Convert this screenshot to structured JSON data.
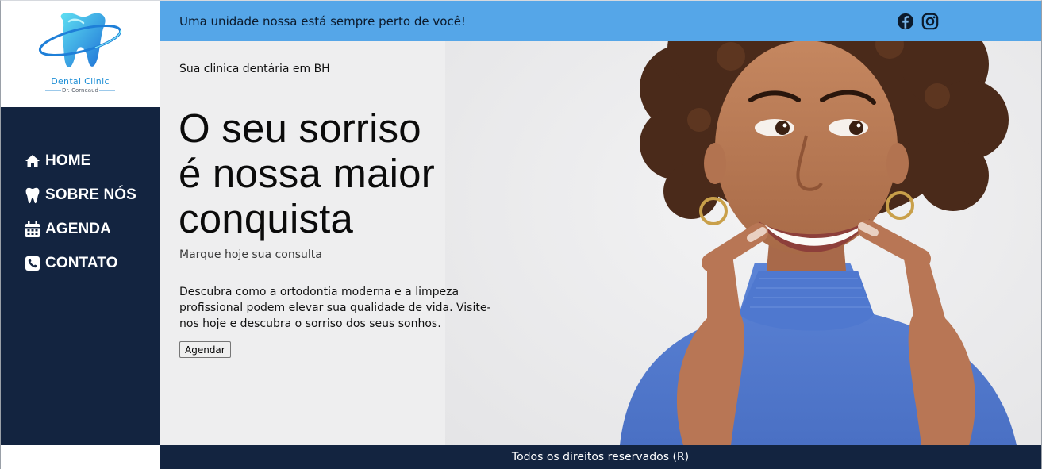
{
  "brand": {
    "name": "Dental Clinic",
    "subtitle": "Dr. Corneaud",
    "logo_icon": "tooth-orbit-logo",
    "logo_color": "#1f8fd6"
  },
  "sidebar": {
    "background": "#132440",
    "items": [
      {
        "label": "HOME",
        "icon": "home-icon"
      },
      {
        "label": "SOBRE NÓS",
        "icon": "tooth-icon"
      },
      {
        "label": "AGENDA",
        "icon": "calendar-icon"
      },
      {
        "label": "CONTATO",
        "icon": "phone-icon"
      }
    ]
  },
  "topbar": {
    "message": "Uma unidade nossa está sempre perto de você!",
    "background": "#55a6e8",
    "social": [
      "facebook-icon",
      "instagram-icon"
    ]
  },
  "hero": {
    "tagline": "Sua clinica dentária em BH",
    "headline_lines": [
      "O seu sorriso",
      "é nossa maior",
      "conquista"
    ],
    "subhead": "Marque hoje sua consulta",
    "description": "Descubra como a ortodontia moderna e a limpeza profissional podem elevar sua qualidade de vida. Visite-nos hoje e descubra o sorriso dos seus sonhos.",
    "cta_label": "Agendar"
  },
  "footer": {
    "text": "Todos os direitos reservados (R)"
  }
}
